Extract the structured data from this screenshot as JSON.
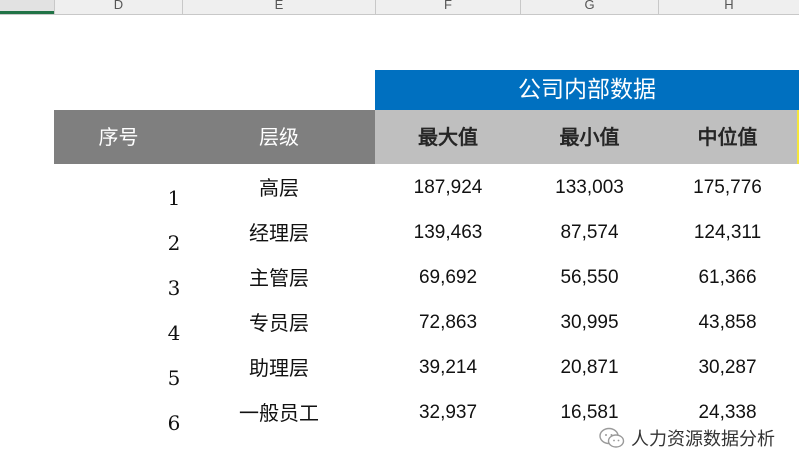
{
  "column_headers": [
    "D",
    "E",
    "F",
    "G",
    "H"
  ],
  "table": {
    "title": "公司内部数据",
    "headers": {
      "seq": "序号",
      "level": "层级",
      "max": "最大值",
      "min": "最小值",
      "median": "中位值"
    },
    "rows": [
      {
        "seq": "1",
        "level": "高层",
        "max": "187,924",
        "min": "133,003",
        "median": "175,776"
      },
      {
        "seq": "2",
        "level": "经理层",
        "max": "139,463",
        "min": "87,574",
        "median": "124,311"
      },
      {
        "seq": "3",
        "level": "主管层",
        "max": "69,692",
        "min": "56,550",
        "median": "61,366"
      },
      {
        "seq": "4",
        "level": "专员层",
        "max": "72,863",
        "min": "30,995",
        "median": "43,858"
      },
      {
        "seq": "5",
        "level": "助理层",
        "max": "39,214",
        "min": "20,871",
        "median": "30,287"
      },
      {
        "seq": "6",
        "level": "一般员工",
        "max": "32,937",
        "min": "16,581",
        "median": "24,338"
      }
    ]
  },
  "watermark": {
    "text": "人力资源数据分析",
    "icon": "wechat-icon"
  },
  "colors": {
    "banner": "#0070c0",
    "header_dark": "#7f7f7f",
    "header_light": "#bfbfbf",
    "selection_accent": "#217346"
  }
}
